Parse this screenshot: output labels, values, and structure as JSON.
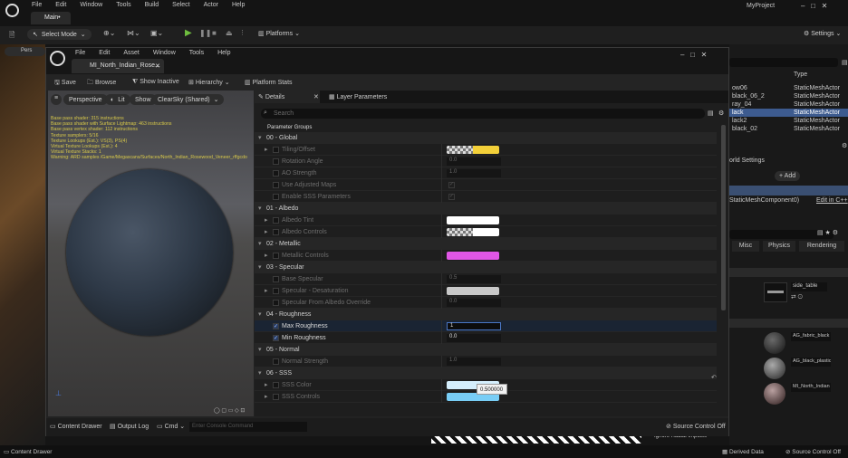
{
  "main": {
    "menu": [
      "File",
      "Edit",
      "Window",
      "Tools",
      "Build",
      "Select",
      "Actor",
      "Help"
    ],
    "tab": "Main•",
    "project": "MyProject",
    "select_mode": "Select Mode",
    "platforms": "Platforms",
    "settings": "Settings"
  },
  "right": {
    "type_header": "Type",
    "outliner": [
      {
        "name": "ow06",
        "type": "StaticMeshActor"
      },
      {
        "name": "black_06_2",
        "type": "StaticMeshActor"
      },
      {
        "name": "ray_04",
        "type": "StaticMeshActor"
      },
      {
        "name": "lack",
        "type": "StaticMeshActor"
      },
      {
        "name": "lack2",
        "type": "StaticMeshActor"
      },
      {
        "name": "black_02",
        "type": "StaticMeshActor"
      }
    ],
    "world_settings": "orld Settings",
    "add": "+ Add",
    "component": "StaticMeshComponent0)",
    "edit_cpp": "Edit in C++",
    "tabs": [
      "Misc",
      "Physics",
      "Rendering"
    ],
    "mesh": "side_table",
    "materials": [
      "AG_fabric_black",
      "AG_black_plastic",
      "MI_North_Indian"
    ]
  },
  "win": {
    "menu": [
      "File",
      "Edit",
      "Asset",
      "Window",
      "Tools",
      "Help"
    ],
    "tab": "MI_North_Indian_Rose...",
    "toolbar": {
      "save": "Save",
      "browse": "Browse",
      "show_inactive": "Show Inactive",
      "hierarchy": "Hierarchy",
      "platform_stats": "Platform Stats"
    }
  },
  "viewport": {
    "perspective": "Perspective",
    "lit": "Lit",
    "show": "Show",
    "clearsky": "ClearSky (Shared)",
    "stats": [
      "Base pass shader: 315 instructions",
      "Base pass shader with Surface Lightmap: 463 instructions",
      "Base pass vertex shader: 112 instructions",
      "Texture samplers: 5/16",
      "Texture Lookups (Est.): VS(3), PS(4)",
      "Virtual Texture Lookups (Est.): 4",
      "Virtual Texture Stacks: 1",
      "Warning: ARD samples /Game/Megascans/Surfaces/North_Indian_Rosewood_Veneer_rffgcdo"
    ]
  },
  "details": {
    "tab": "Details",
    "tab2": "Layer Parameters",
    "search_placeholder": "Search",
    "groups_label": "Parameter Groups",
    "rows": [
      {
        "kind": "group",
        "label": "00 - Global"
      },
      {
        "kind": "param",
        "label": "Tiling/Offset",
        "on": false,
        "arrow": true,
        "swatch": "checker-yellow"
      },
      {
        "kind": "param",
        "label": "Rotation Angle",
        "on": false,
        "value": "0.0"
      },
      {
        "kind": "param",
        "label": "AO Strength",
        "on": false,
        "value": "1.0"
      },
      {
        "kind": "param",
        "label": "Use Adjusted Maps",
        "on": false,
        "check": true
      },
      {
        "kind": "param",
        "label": "Enable SSS Parameters",
        "on": false,
        "check": true
      },
      {
        "kind": "group",
        "label": "01 - Albedo"
      },
      {
        "kind": "param",
        "label": "Albedo Tint",
        "on": false,
        "arrow": true,
        "swatch": "#ffffff"
      },
      {
        "kind": "param",
        "label": "Albedo Controls",
        "on": false,
        "arrow": true,
        "swatch": "checker-white"
      },
      {
        "kind": "group",
        "label": "02 - Metallic"
      },
      {
        "kind": "param",
        "label": "Metallic Controls",
        "on": false,
        "arrow": true,
        "swatch": "#e056e6"
      },
      {
        "kind": "group",
        "label": "03 - Specular"
      },
      {
        "kind": "param",
        "label": "Base Specular",
        "on": false,
        "value": "0.5"
      },
      {
        "kind": "param",
        "label": "Specular - Desaturation",
        "on": false,
        "arrow": true,
        "swatch": "#c8c8c8"
      },
      {
        "kind": "param",
        "label": "Specular From Albedo Override",
        "on": false,
        "value": "0.0"
      },
      {
        "kind": "group",
        "label": "04 - Roughness"
      },
      {
        "kind": "param",
        "label": "Max Roughness",
        "on": true,
        "value": "1",
        "active": true
      },
      {
        "kind": "param",
        "label": "Min Roughness",
        "on": true,
        "value": "0.0"
      },
      {
        "kind": "group",
        "label": "05 - Normal"
      },
      {
        "kind": "param",
        "label": "Normal Strength",
        "on": false,
        "value": "1.0"
      },
      {
        "kind": "group",
        "label": "06 - SSS"
      },
      {
        "kind": "param",
        "label": "SSS Color",
        "on": false,
        "arrow": true,
        "swatch": "#d4eefc"
      },
      {
        "kind": "param",
        "label": "SSS Controls",
        "on": false,
        "arrow": true,
        "swatch": "#78cdf5"
      }
    ],
    "tooltip": "0.500000"
  },
  "bottom": {
    "content_drawer": "Content Drawer",
    "output_log": "Output Log",
    "cmd": "Cmd",
    "console_placeholder": "Enter Console Command",
    "source_control": "Source Control Off",
    "content_drawer2": "Content Drawer",
    "ignore_radial": "Ignore Radial Impulse",
    "derived_data": "Derived Data",
    "source_control2": "Source Control Off"
  }
}
